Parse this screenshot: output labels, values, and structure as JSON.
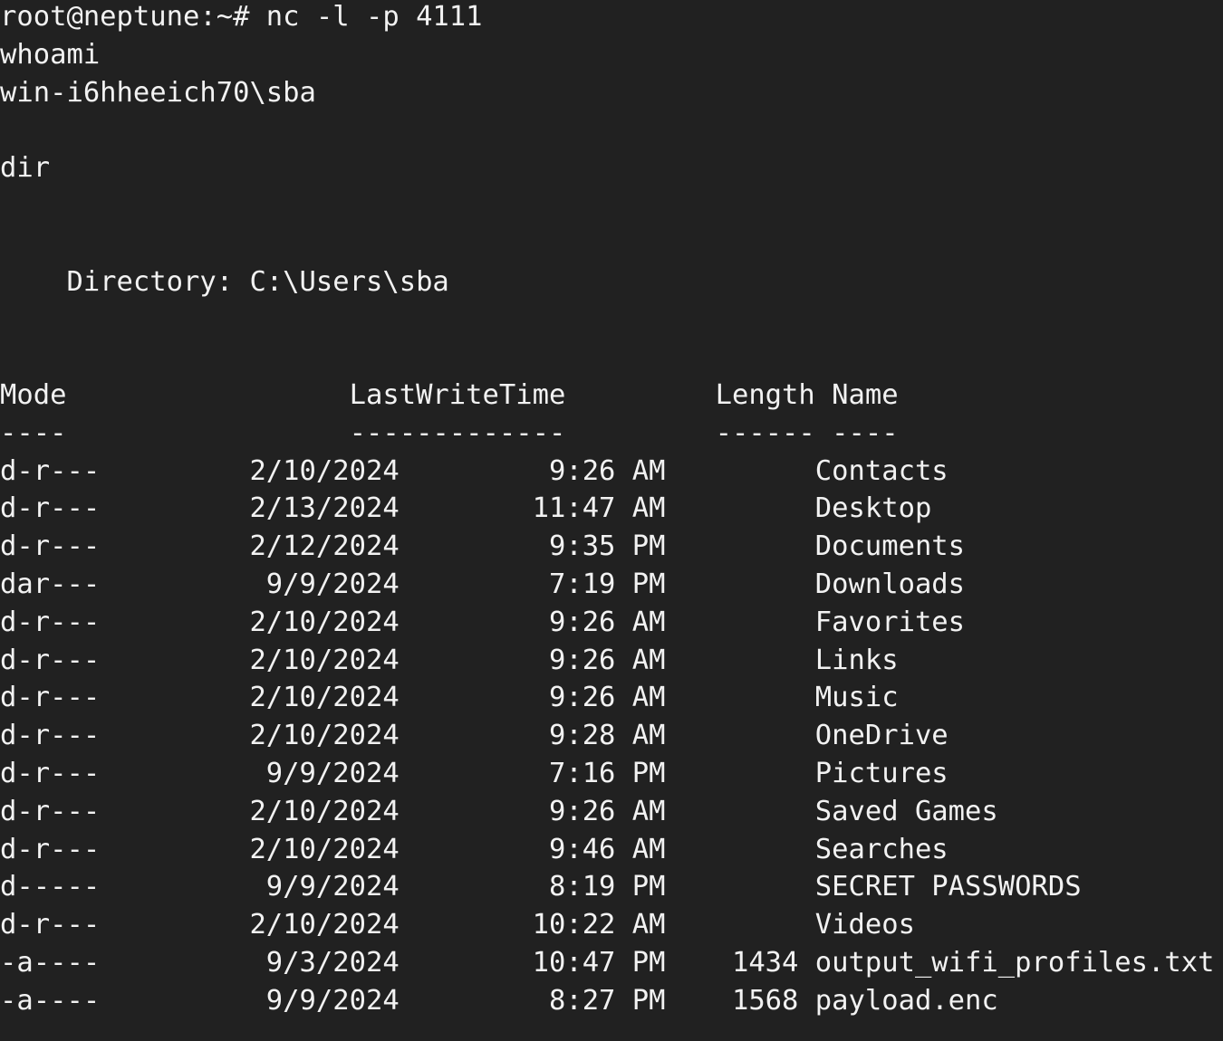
{
  "terminal": {
    "background_color": "#212121",
    "foreground_color": "#f2f2f2",
    "prompt": "root@neptune:~#",
    "command": "nc -l -p 4111",
    "prompt_line": "root@neptune:~# nc -l -p 4111",
    "sent_command_1": "whoami",
    "whoami_result": "win-i6hheeich70\\sba",
    "sent_command_2": "dir",
    "directory_header": "    Directory: C:\\Users\\sba",
    "directory_label": "Directory:",
    "directory_path": "C:\\Users\\sba",
    "columns": {
      "mode": "Mode",
      "lastwritetime": "LastWriteTime",
      "length": "Length",
      "name": "Name"
    },
    "column_rules": {
      "mode": "----",
      "lastwritetime": "-------------",
      "length": "------",
      "name": "----"
    },
    "header_line": "Mode                 LastWriteTime         Length Name",
    "rule_line": "----                 -------------         ------ ----",
    "entries": [
      {
        "mode": "d-r---",
        "date": "2/10/2024",
        "time": "9:26 AM",
        "length": "",
        "name": "Contacts"
      },
      {
        "mode": "d-r---",
        "date": "2/13/2024",
        "time": "11:47 AM",
        "length": "",
        "name": "Desktop"
      },
      {
        "mode": "d-r---",
        "date": "2/12/2024",
        "time": "9:35 PM",
        "length": "",
        "name": "Documents"
      },
      {
        "mode": "dar---",
        "date": "9/9/2024",
        "time": "7:19 PM",
        "length": "",
        "name": "Downloads"
      },
      {
        "mode": "d-r---",
        "date": "2/10/2024",
        "time": "9:26 AM",
        "length": "",
        "name": "Favorites"
      },
      {
        "mode": "d-r---",
        "date": "2/10/2024",
        "time": "9:26 AM",
        "length": "",
        "name": "Links"
      },
      {
        "mode": "d-r---",
        "date": "2/10/2024",
        "time": "9:26 AM",
        "length": "",
        "name": "Music"
      },
      {
        "mode": "d-r---",
        "date": "2/10/2024",
        "time": "9:28 AM",
        "length": "",
        "name": "OneDrive"
      },
      {
        "mode": "d-r---",
        "date": "9/9/2024",
        "time": "7:16 PM",
        "length": "",
        "name": "Pictures"
      },
      {
        "mode": "d-r---",
        "date": "2/10/2024",
        "time": "9:26 AM",
        "length": "",
        "name": "Saved Games"
      },
      {
        "mode": "d-r---",
        "date": "2/10/2024",
        "time": "9:46 AM",
        "length": "",
        "name": "Searches"
      },
      {
        "mode": "d-----",
        "date": "9/9/2024",
        "time": "8:19 PM",
        "length": "",
        "name": "SECRET PASSWORDS"
      },
      {
        "mode": "d-r---",
        "date": "2/10/2024",
        "time": "10:22 AM",
        "length": "",
        "name": "Videos"
      },
      {
        "mode": "-a----",
        "date": "9/3/2024",
        "time": "10:47 PM",
        "length": "1434",
        "name": "output_wifi_profiles.txt"
      },
      {
        "mode": "-a----",
        "date": "9/9/2024",
        "time": "8:27 PM",
        "length": "1568",
        "name": "payload.enc"
      }
    ],
    "layout": {
      "mode_col": 0,
      "date_end_col": 24,
      "time_end_col": 40,
      "length_end_col": 48,
      "name_col": 49
    }
  }
}
